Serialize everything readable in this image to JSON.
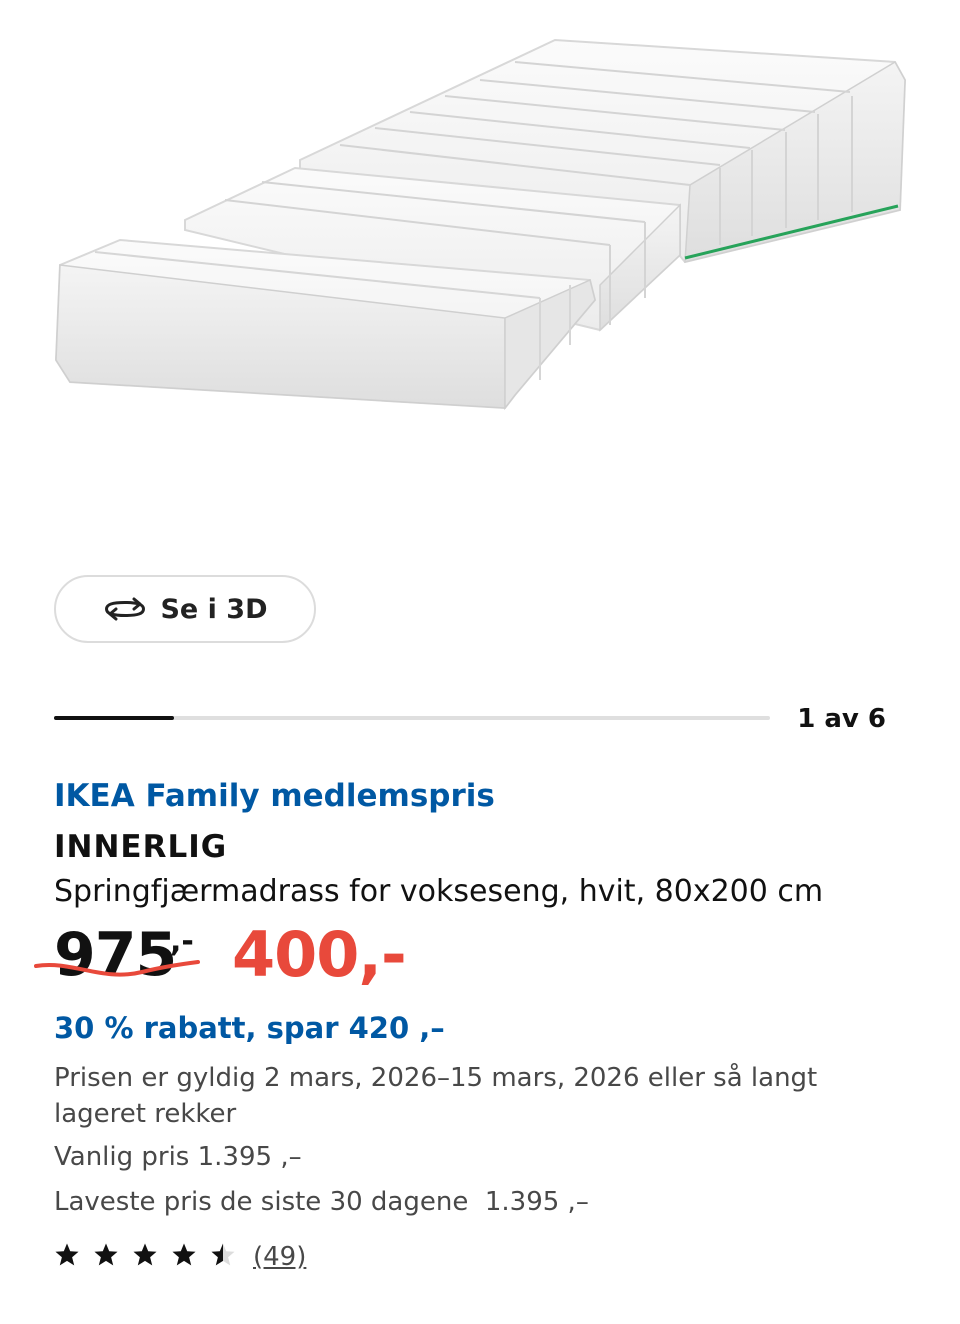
{
  "actions": {
    "view_3d_label": "Se i 3D"
  },
  "gallery": {
    "position": "1 av 6",
    "progress_fraction": 0.167
  },
  "product": {
    "family_label": "IKEA Family medlemspris",
    "name": "INNERLIG",
    "description": "Springfjærmadrass for vokseseng, hvit, 80x200 cm",
    "old_price": "975",
    "old_price_suffix": ",-",
    "new_price": "400,-",
    "discount": "30 % rabatt, spar 420 ,–",
    "validity": "Prisen er gyldig 2 mars, 2026–15 mars, 2026 eller så langt lageret rekker",
    "regular_price": "Vanlig pris 1.395 ,–",
    "lowest_price": "Laveste pris de siste 30 dagene  1.395 ,–",
    "rating_value": 4.5,
    "review_count": "(49)"
  },
  "colors": {
    "family_blue": "#0058a3",
    "sale_red": "#e8493b",
    "text_grey": "#484848"
  },
  "icons": {
    "rotate": "rotate-3d-icon",
    "star": "star-icon"
  }
}
